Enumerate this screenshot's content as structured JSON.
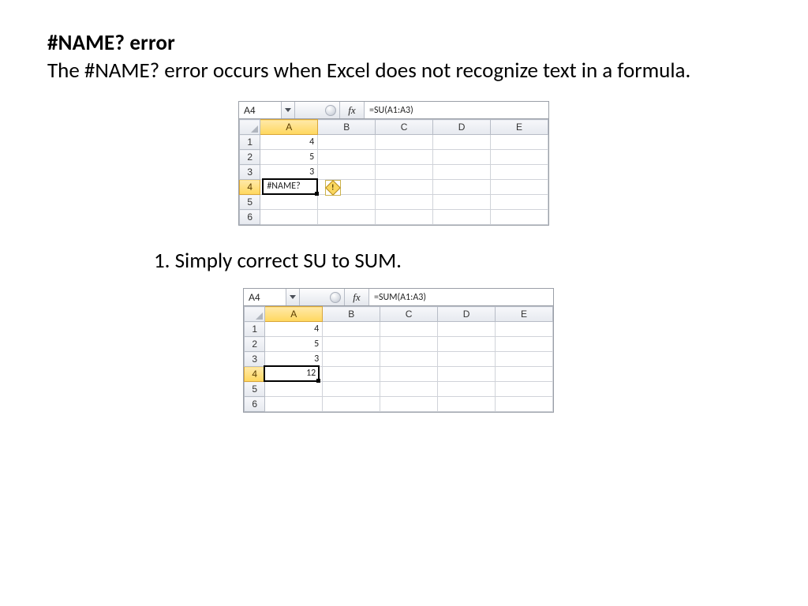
{
  "heading": "#NAME? error",
  "intro": "The #NAME? error occurs when Excel does not recognize text in a formula.",
  "step1": "1. Simply correct SU to SUM.",
  "shot1": {
    "namebox": "A4",
    "fx_label": "fx",
    "formula": "=SU(A1:A3)",
    "col_headers": [
      "A",
      "B",
      "C",
      "D",
      "E"
    ],
    "row_headers": [
      "1",
      "2",
      "3",
      "4",
      "5",
      "6"
    ],
    "colA": [
      "4",
      "5",
      "3",
      "#NAME?",
      "",
      ""
    ],
    "selected_cell_text": "#NAME?",
    "has_error_tag": true
  },
  "shot2": {
    "namebox": "A4",
    "fx_label": "fx",
    "formula": "=SUM(A1:A3)",
    "col_headers": [
      "A",
      "B",
      "C",
      "D",
      "E"
    ],
    "row_headers": [
      "1",
      "2",
      "3",
      "4",
      "5",
      "6"
    ],
    "colA": [
      "4",
      "5",
      "3",
      "12",
      "",
      ""
    ],
    "selected_cell_text": "12",
    "has_error_tag": false
  }
}
